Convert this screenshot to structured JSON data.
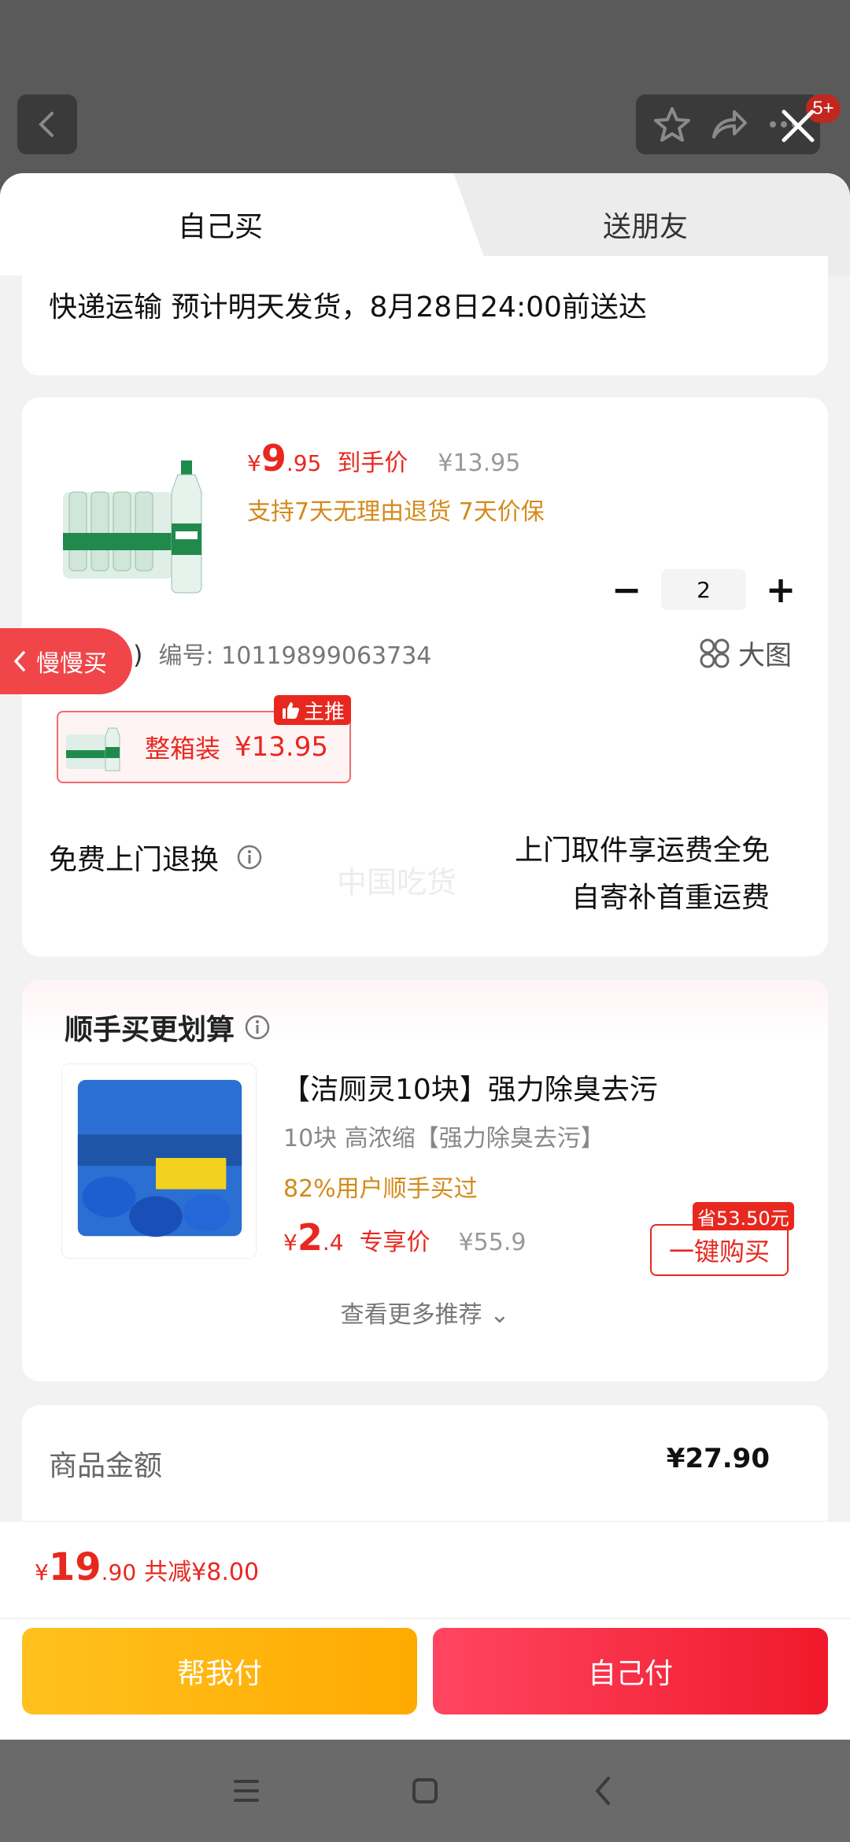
{
  "header": {
    "badge_count": "5+"
  },
  "tabs": {
    "active": "自己买",
    "other": "送朋友"
  },
  "shipping": {
    "text": "快递运输 预计明天发货，8月28日24:00前送达"
  },
  "product": {
    "currency": "¥",
    "price_int": "9",
    "price_dec": ".95",
    "price_tag": "到手价",
    "original_price": "¥13.95",
    "support": "支持7天无理由退货 7天价保",
    "quantity": "2",
    "spec_label": "规格 (1)",
    "spec_number": "编号: 10119899063734",
    "big_image": "大图",
    "sku_name": "整箱装",
    "sku_price": "¥13.95",
    "sku_badge": "主推",
    "return_label": "免费上门退换",
    "return_line1": "上门取件享运费全免",
    "return_line2": "自寄补首重运费",
    "watermark": "中国吃货"
  },
  "slow_buy": {
    "label": "慢慢买"
  },
  "recommend": {
    "title": "顺手买更划算",
    "name": "【洁厕灵10块】强力除臭去污",
    "sub": "10块 高浓缩【强力除臭去污】",
    "buyers": "82%用户顺手买过",
    "currency": "¥",
    "price_int": "2",
    "price_dec": ".4",
    "price_tag": "专享价",
    "original_price": "¥55.9",
    "save_badge": "省53.50元",
    "buy_button": "一键购买",
    "more": "查看更多推荐 ⌄"
  },
  "summary": {
    "label": "商品金额",
    "value": "¥27.90"
  },
  "footer": {
    "currency": "¥",
    "total_int": "19",
    "total_dec": ".90",
    "reduce": "共减¥8.00",
    "help_pay": "帮我付",
    "self_pay": "自己付"
  },
  "colors": {
    "accent_red": "#e8281f",
    "orange": "#d48a1a",
    "yellow_button": "#ffb20f",
    "red_button": "#f0192b"
  }
}
